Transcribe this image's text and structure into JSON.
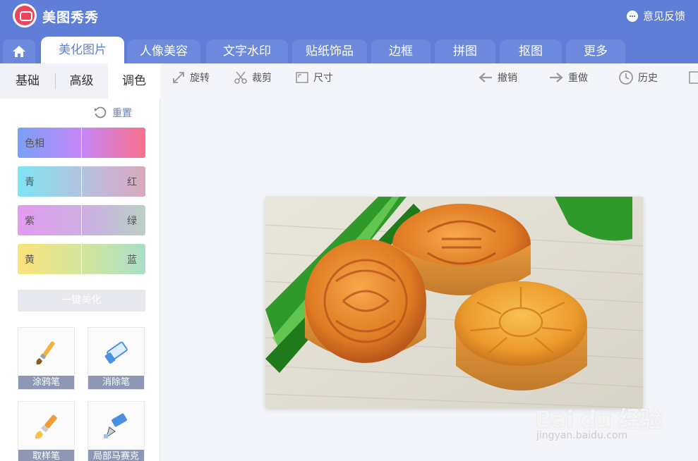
{
  "app": {
    "title": "美图秀秀",
    "feedback_label": "意见反馈"
  },
  "tabs": [
    {
      "label": "美化图片",
      "active": true
    },
    {
      "label": "人像美容"
    },
    {
      "label": "文字水印"
    },
    {
      "label": "贴纸饰品"
    },
    {
      "label": "边框"
    },
    {
      "label": "拼图"
    },
    {
      "label": "抠图"
    },
    {
      "label": "更多"
    }
  ],
  "subtabs": [
    {
      "label": "基础"
    },
    {
      "label": "高级"
    },
    {
      "label": "调色",
      "active": true
    }
  ],
  "reset_label": "重置",
  "sliders": [
    {
      "left": "色相",
      "right": ""
    },
    {
      "left": "青",
      "right": "红"
    },
    {
      "left": "紫",
      "right": "绿"
    },
    {
      "left": "黄",
      "right": "蓝"
    }
  ],
  "onekey_label": "一键美化",
  "tools": [
    {
      "label": "涂鸦笔",
      "icon": "brush-icon"
    },
    {
      "label": "消除笔",
      "icon": "eraser-icon"
    },
    {
      "label": "取样笔",
      "icon": "sampling-brush-icon"
    },
    {
      "label": "局部马赛克",
      "icon": "mosaic-pen-icon"
    }
  ],
  "toolbar": {
    "rotate": "旋转",
    "crop": "裁剪",
    "size": "尺寸",
    "undo": "撤销",
    "redo": "重做",
    "history": "历史"
  },
  "watermark": {
    "main": "Bai du 经验",
    "sub": "jingyan.baidu.com"
  },
  "colors": {
    "brand": "#5f7ed8",
    "tab_inactive": "#6c89de",
    "caption": "#8e98b6"
  }
}
